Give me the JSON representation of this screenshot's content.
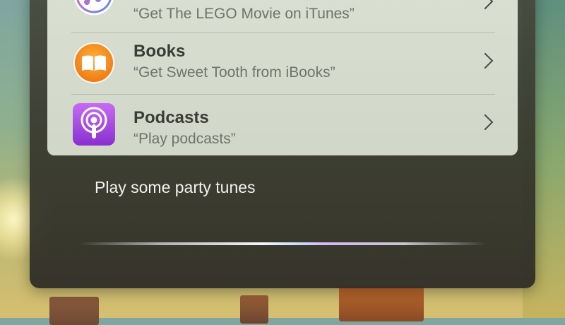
{
  "siri": {
    "results": [
      {
        "app": "iTunes",
        "title": "",
        "subtitle": "“Get The LEGO Movie on iTunes”",
        "icon": "itunes-icon"
      },
      {
        "app": "Books",
        "title": "Books",
        "subtitle": "“Get Sweet Tooth from iBooks”",
        "icon": "books-icon"
      },
      {
        "app": "Podcasts",
        "title": "Podcasts",
        "subtitle": "“Play podcasts”",
        "icon": "podcasts-icon"
      }
    ],
    "query": "Play some party tunes"
  },
  "colors": {
    "books_orange": "#f28a1b",
    "podcasts_purple": "#9b3fd6",
    "itunes_blue": "#5a8cf0"
  }
}
